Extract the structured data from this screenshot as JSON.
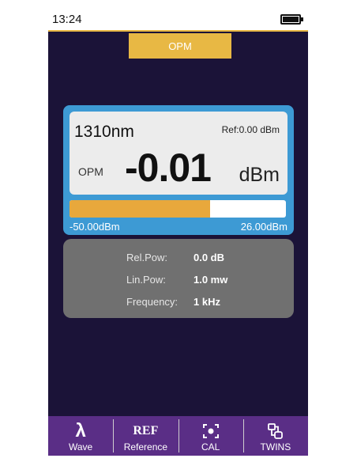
{
  "status_bar": {
    "time": "13:24"
  },
  "header": {
    "title": "OPM"
  },
  "meter": {
    "wavelength": "1310nm",
    "ref": "Ref:0.00  dBm",
    "mode": "OPM",
    "power": "-0.01",
    "unit": "dBm",
    "level_fraction": 0.65,
    "range_min": "-50.00dBm",
    "range_max": "26.00dBm"
  },
  "info": {
    "rows": [
      {
        "label": "Rel.Pow:",
        "value": "0.0 dB"
      },
      {
        "label": "Lin.Pow:",
        "value": "1.0 mw"
      },
      {
        "label": "Frequency:",
        "value": "1 kHz"
      }
    ]
  },
  "toolbar": {
    "items": [
      {
        "glyph": "λ",
        "label": "Wave",
        "icon": "lambda-icon"
      },
      {
        "glyph": "REF",
        "label": "Reference",
        "icon": "ref-icon"
      },
      {
        "glyph": "",
        "label": "CAL",
        "icon": "calibration-target-icon"
      },
      {
        "glyph": "",
        "label": "TWINS",
        "icon": "twins-connector-icon"
      }
    ]
  },
  "colors": {
    "background": "#1b1338",
    "accent": "#e8b844",
    "meter_frame": "#3d9ad4",
    "bar_fill": "#e8a83c",
    "toolbar": "#5a2e86",
    "info_panel": "#707070"
  }
}
